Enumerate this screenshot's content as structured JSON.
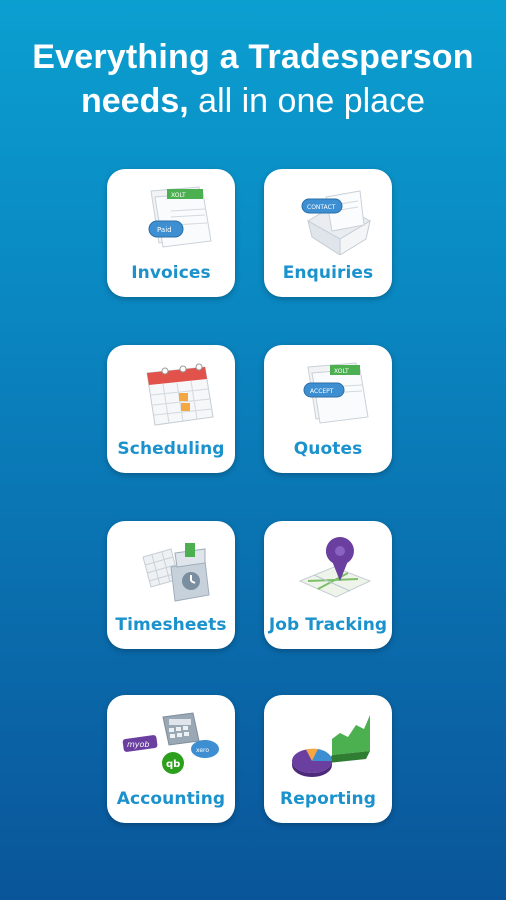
{
  "headline": {
    "line1": "Everything a Tradesperson",
    "line2_bold": "needs,",
    "line2_light": " all in one place"
  },
  "tiles": [
    {
      "label": "Invoices",
      "icon": "invoice-icon"
    },
    {
      "label": "Enquiries",
      "icon": "enquiries-icon"
    },
    {
      "label": "Scheduling",
      "icon": "calendar-icon"
    },
    {
      "label": "Quotes",
      "icon": "quotes-icon"
    },
    {
      "label": "Timesheets",
      "icon": "timesheet-icon"
    },
    {
      "label": "Job Tracking",
      "icon": "map-pin-icon"
    },
    {
      "label": "Accounting",
      "icon": "accounting-icon"
    },
    {
      "label": "Reporting",
      "icon": "chart-icon"
    }
  ],
  "illustration_text": {
    "invoice_tag": "Paid",
    "invoice_header": "XOLT",
    "enquiry_tag": "CONTACT",
    "quote_tag": "ACCEPT",
    "quote_header": "XOLT",
    "myob": "myob",
    "qb": "qb",
    "sage": "xero"
  },
  "colors": {
    "background_top": "#0b9fd0",
    "background_bottom": "#0a559a",
    "tile": "#ffffff",
    "label": "#1b92cc",
    "accent_green": "#4caf50",
    "accent_purple": "#6a3fa0",
    "accent_red": "#e0524a"
  }
}
